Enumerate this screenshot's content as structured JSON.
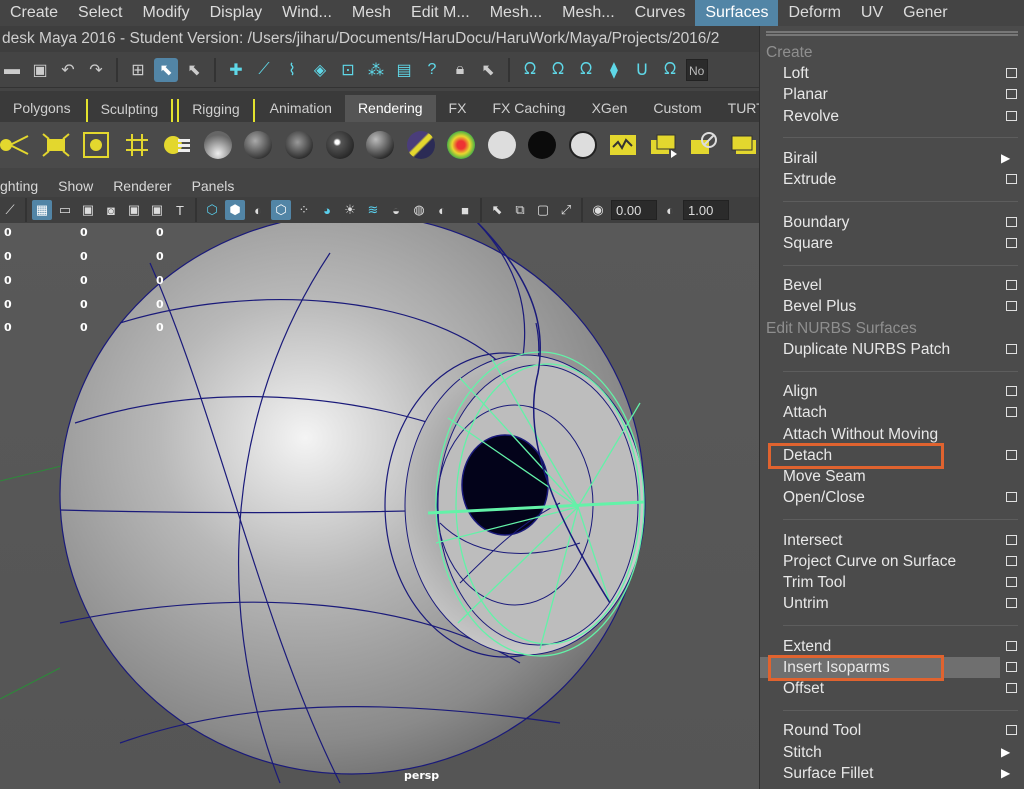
{
  "menubar": {
    "items": [
      "Create",
      "Select",
      "Modify",
      "Display",
      "Wind...",
      "Mesh",
      "Edit M...",
      "Mesh...",
      "Mesh...",
      "Curves",
      "Surfaces",
      "Deform",
      "UV",
      "Gener"
    ],
    "active": "Surfaces"
  },
  "title": "desk Maya 2016 - Student Version: /Users/jiharu/Documents/HaruDocu/HaruWork/Maya/Projects/2016/2",
  "status": {
    "no_field": "No"
  },
  "shelf_tabs": [
    "Polygons",
    "Sculpting",
    "Rigging",
    "Animation",
    "Rendering",
    "FX",
    "FX Caching",
    "XGen",
    "Custom",
    "TURTL"
  ],
  "shelf_active_tab": "Rendering",
  "panel_menu": [
    "ghting",
    "Show",
    "Renderer",
    "Panels"
  ],
  "panel_toolbar": {
    "value1": "0.00",
    "value2": "1.00"
  },
  "viewport": {
    "camera_label": "persp",
    "hud_rows": [
      [
        "0",
        "0",
        "0"
      ],
      [
        "0",
        "0",
        "0"
      ],
      [
        "0",
        "0",
        "0"
      ],
      [
        "0",
        "0",
        "0"
      ],
      [
        "0",
        "0",
        "0"
      ]
    ]
  },
  "dropdown": {
    "items": [
      {
        "type": "header",
        "label": "Create"
      },
      {
        "label": "Loft",
        "opt": true
      },
      {
        "label": "Planar",
        "opt": true
      },
      {
        "label": "Revolve",
        "opt": true
      },
      {
        "type": "sep"
      },
      {
        "label": "Birail",
        "sub": true
      },
      {
        "label": "Extrude",
        "opt": true
      },
      {
        "type": "sep"
      },
      {
        "label": "Boundary",
        "opt": true
      },
      {
        "label": "Square",
        "opt": true
      },
      {
        "type": "sep"
      },
      {
        "label": "Bevel",
        "opt": true
      },
      {
        "label": "Bevel Plus",
        "opt": true
      },
      {
        "type": "header",
        "label": "Edit NURBS Surfaces"
      },
      {
        "label": "Duplicate NURBS Patch",
        "opt": true
      },
      {
        "type": "sep"
      },
      {
        "label": "Align",
        "opt": true
      },
      {
        "label": "Attach",
        "opt": true
      },
      {
        "label": "Attach Without Moving"
      },
      {
        "label": "Detach",
        "opt": true,
        "callout": true
      },
      {
        "label": "Move Seam"
      },
      {
        "label": "Open/Close",
        "opt": true
      },
      {
        "type": "sep"
      },
      {
        "label": "Intersect",
        "opt": true
      },
      {
        "label": "Project Curve on Surface",
        "opt": true
      },
      {
        "label": "Trim Tool",
        "opt": true
      },
      {
        "label": "Untrim",
        "opt": true
      },
      {
        "type": "sep"
      },
      {
        "label": "Extend",
        "opt": true
      },
      {
        "label": "Insert Isoparms",
        "opt": true,
        "highlight": true,
        "callout": true
      },
      {
        "label": "Offset",
        "opt": true
      },
      {
        "type": "sep"
      },
      {
        "label": "Round Tool",
        "opt": true
      },
      {
        "label": "Stitch",
        "sub": true
      },
      {
        "label": "Surface Fillet",
        "sub": true
      }
    ]
  },
  "colors": {
    "accent": "#5285a6",
    "callout": "#e0632f",
    "wire": "#1a1a7a",
    "selected_wire": "#63f2a8"
  }
}
